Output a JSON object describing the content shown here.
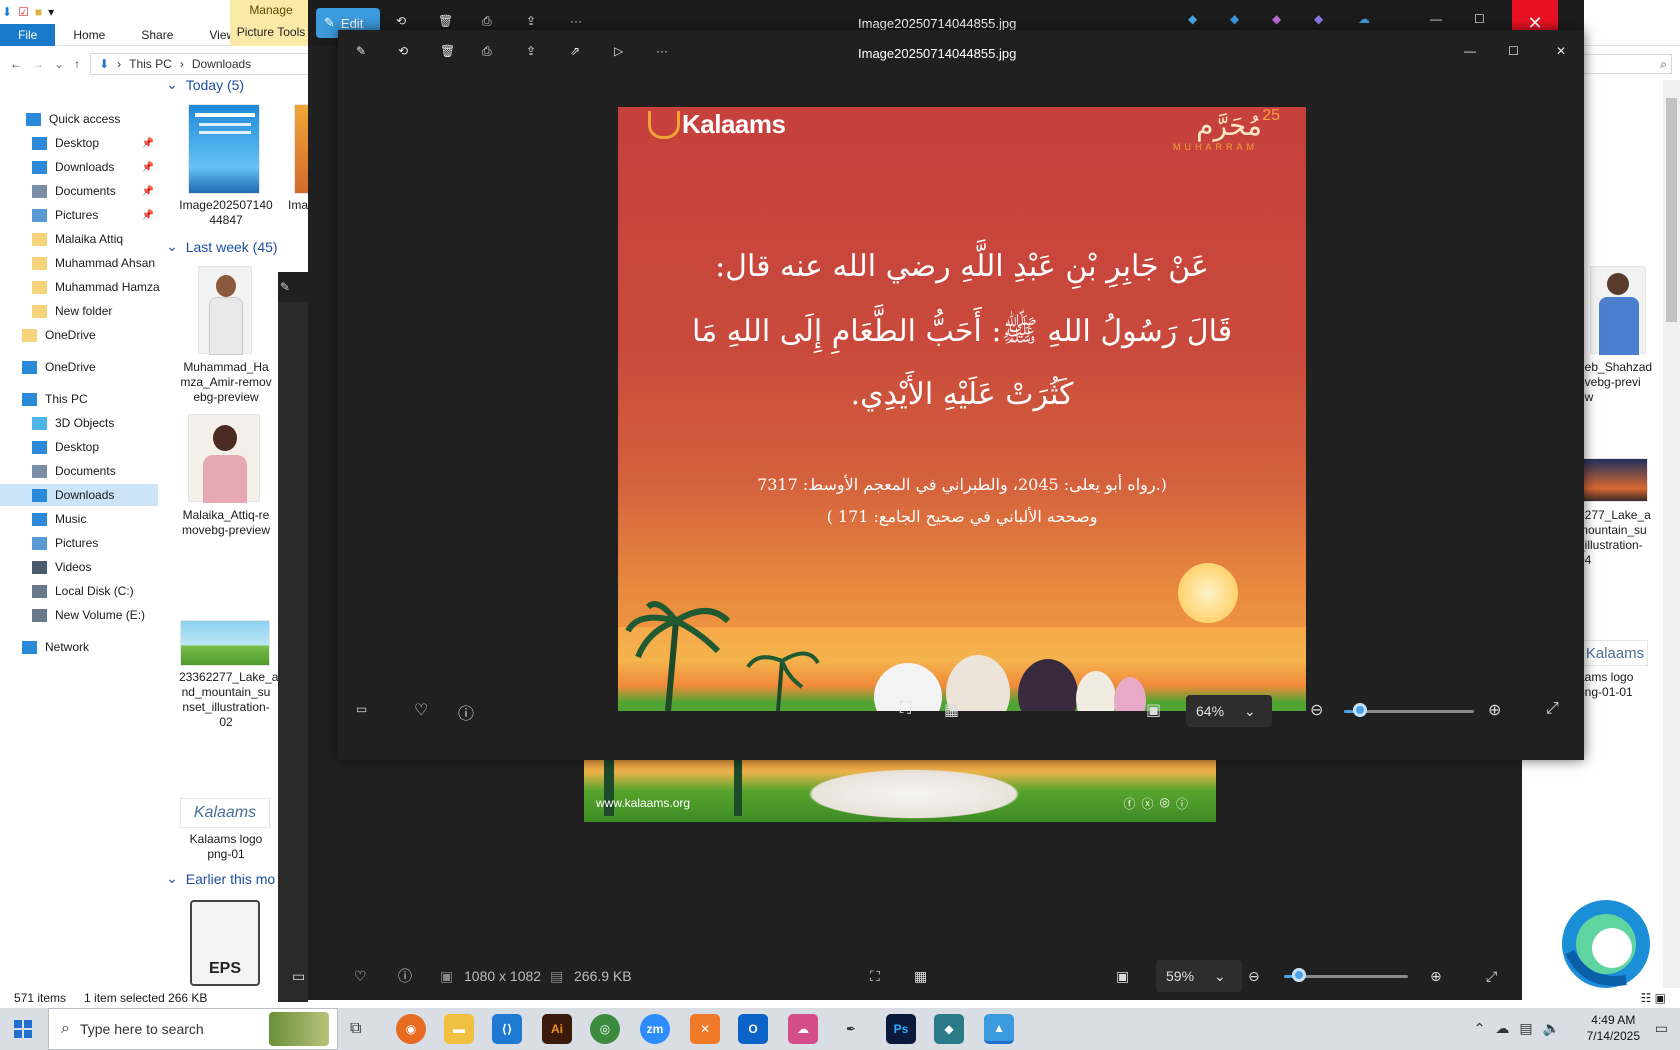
{
  "explorer": {
    "ribbon_tabs": [
      "File",
      "Home",
      "Share",
      "View"
    ],
    "manage": {
      "top": "Manage",
      "bottom": "Picture Tools"
    },
    "breadcrumb": [
      "This PC",
      "Downloads"
    ],
    "nav": [
      {
        "label": "Quick access",
        "icon": "star-icon",
        "y": 0
      },
      {
        "label": "Desktop",
        "icon": "desktop-icon",
        "pinned": true
      },
      {
        "label": "Downloads",
        "icon": "downloads-icon",
        "pinned": true
      },
      {
        "label": "Documents",
        "icon": "documents-icon",
        "pinned": true
      },
      {
        "label": "Pictures",
        "icon": "pictures-icon",
        "pinned": true
      },
      {
        "label": "Malaika Attiq",
        "icon": "folder-icon"
      },
      {
        "label": "Muhammad Ahsan",
        "icon": "folder-icon"
      },
      {
        "label": "Muhammad Hamza",
        "icon": "folder-icon"
      },
      {
        "label": "New folder",
        "icon": "folder-icon"
      },
      {
        "label": "OneDrive",
        "icon": "folder-icon"
      },
      {
        "label": "OneDrive",
        "icon": "cloud-icon"
      },
      {
        "label": "This PC",
        "icon": "pc-icon"
      },
      {
        "label": "3D Objects",
        "icon": "cube-icon"
      },
      {
        "label": "Desktop",
        "icon": "desktop-icon"
      },
      {
        "label": "Documents",
        "icon": "documents-icon"
      },
      {
        "label": "Downloads",
        "icon": "downloads-icon",
        "selected": true
      },
      {
        "label": "Music",
        "icon": "music-icon"
      },
      {
        "label": "Pictures",
        "icon": "pictures-icon"
      },
      {
        "label": "Videos",
        "icon": "videos-icon"
      },
      {
        "label": "Local Disk (C:)",
        "icon": "drive-icon"
      },
      {
        "label": "New Volume (E:)",
        "icon": "drive-icon"
      },
      {
        "label": "Network",
        "icon": "network-icon"
      }
    ],
    "groups": {
      "today": "Today (5)",
      "last_week": "Last week (45)",
      "earlier": "Earlier this mo"
    },
    "files": {
      "f1": "Image202507140 44847",
      "f2": "Ima",
      "f3": "Muhammad_Ha mza_Amir-remov ebg-preview",
      "f4": "Malaika_Attiq-re movebg-preview",
      "f5": "23362277_Lake_a nd_mountain_su nset_illustration- 02",
      "f6": "Kalaams logo png-01",
      "f7": "EPS",
      "r1": "eeb_Shahzad ovebg-previ ew",
      "r2": "2277_Lake_a mountain_su _illustration- 04",
      "r3": "aams logo png-01-01"
    },
    "status": {
      "items": "571 items",
      "selected": "1 item selected  266 KB"
    }
  },
  "front": {
    "outer_title": "Image20250714044855.jpg",
    "title": "Image20250714044855.jpg",
    "edit_label": "Edit",
    "zoom": "64%",
    "zoom_fraction": 0.1
  },
  "back": {
    "dimensions": "1080 x 1082",
    "size": "266.9 KB",
    "zoom": "59%",
    "zoom_fraction": 0.1,
    "website": "www.kalaams.org"
  },
  "artwork": {
    "logo": "Kalaams",
    "muharram_day": "25",
    "muharram_ar": "مُحَرَّم",
    "muharram_en": "MUHARRAM",
    "line1": "عَنْ جَابِرِ بْنِ عَبْدِ اللَّهِ رضي الله عنه قال:",
    "line2": "قَالَ رَسُولُ اللهِ ﷺ: أَحَبُّ الطَّعَامِ إِلَى اللهِ مَا",
    "line3": "كَثُرَتْ عَلَيْهِ الأَيْدِي.",
    "ref1": "(.رواه أبو يعلى: 2045، والطبراني في المعجم الأوسط: 7317",
    "ref2": "وصححه الألباني في صحيح الجامع: 171 )"
  },
  "taskbar": {
    "search_placeholder": "Type here to search",
    "time": "4:49 AM",
    "date": "7/14/2025"
  }
}
